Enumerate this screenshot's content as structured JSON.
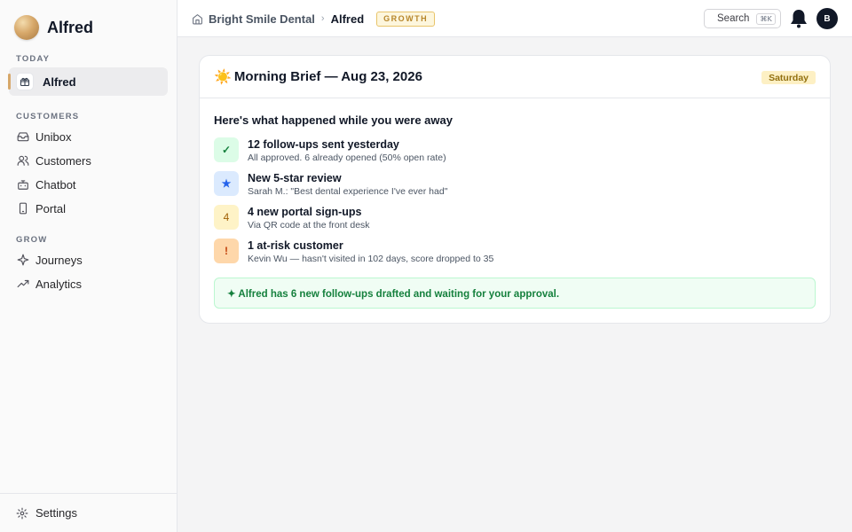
{
  "brand": {
    "name": "Alfred"
  },
  "sidebar": {
    "sections": [
      {
        "label": "TODAY"
      },
      {
        "label": "CUSTOMERS"
      },
      {
        "label": "GROW"
      }
    ],
    "items": [
      {
        "label": "Alfred",
        "icon": "gift-icon"
      },
      {
        "label": "Unibox",
        "icon": "inbox-icon"
      },
      {
        "label": "Customers",
        "icon": "users-icon"
      },
      {
        "label": "Chatbot",
        "icon": "bot-icon"
      },
      {
        "label": "Portal",
        "icon": "phone-icon"
      },
      {
        "label": "Journeys",
        "icon": "sparkle-icon"
      },
      {
        "label": "Analytics",
        "icon": "trend-icon"
      }
    ],
    "footer": {
      "label": "Settings",
      "icon": "gear-icon"
    }
  },
  "topbar": {
    "org": "Bright Smile Dental",
    "separator": "›",
    "current": "Alfred",
    "plan": "GROWTH",
    "search_label": "Search",
    "search_shortcut": "⌘K",
    "avatar_initial": "B"
  },
  "brief": {
    "icon": "☀️",
    "title": "Morning Brief — Aug 23, 2026",
    "day": "Saturday",
    "intro": "Here's what happened while you were away",
    "items": [
      {
        "glyph": "✓",
        "title": "12 follow-ups sent yesterday",
        "subtitle": "All approved. 6 already opened (50% open rate)",
        "color": "#dcfce7",
        "glyph_color": "#15803d"
      },
      {
        "glyph": "★",
        "title": "New 5-star review",
        "subtitle": "Sarah M.: \"Best dental experience I've ever had\"",
        "color": "#dbeafe",
        "glyph_color": "#2563eb"
      },
      {
        "glyph": "4",
        "title": "4 new portal sign-ups",
        "subtitle": "Via QR code at the front desk",
        "color": "#fef3c7",
        "glyph_color": "#a16207"
      },
      {
        "glyph": "!",
        "title": "1 at-risk customer",
        "subtitle": "Kevin Wu — hasn't visited in 102 days, score dropped to 35",
        "color": "#fed7aa",
        "glyph_color": "#c2410c"
      }
    ],
    "callout": "✦ Alfred has 6 new follow-ups drafted and waiting for your approval."
  }
}
